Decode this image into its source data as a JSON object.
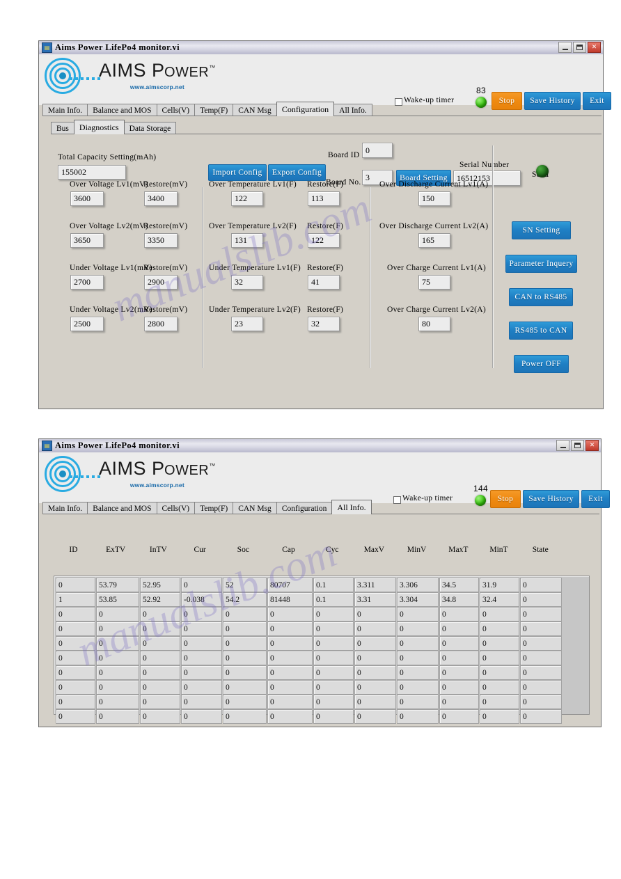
{
  "window1": {
    "title": "Aims Power LifePo4  monitor.vi",
    "titlebar_buttons": [
      "minimize",
      "maximize",
      "close"
    ],
    "logo": {
      "main": "AIMS POWER",
      "tm": "™",
      "url": "www.aimscorp.net"
    },
    "tabs": [
      {
        "label": "Main Info.",
        "active": false
      },
      {
        "label": "Balance and MOS",
        "active": false
      },
      {
        "label": "Cells(V)",
        "active": false
      },
      {
        "label": "Temp(F)",
        "active": false
      },
      {
        "label": "CAN Msg",
        "active": false
      },
      {
        "label": "Configuration",
        "active": true
      },
      {
        "label": "All Info.",
        "active": false
      }
    ],
    "subtabs": [
      {
        "label": "Bus",
        "active": false
      },
      {
        "label": "Diagnostics",
        "active": true
      },
      {
        "label": "Data Storage",
        "active": false
      }
    ],
    "toolbar": {
      "wakeup_label": "Wake-up timer",
      "wakeup_checked": false,
      "counter": "83",
      "stop_label": "Stop",
      "save_history_label": "Save History",
      "exit_label": "Exit"
    },
    "capacity": {
      "label": "Total Capacity Setting(mAh)",
      "value": "155002"
    },
    "import_label": "Import Config",
    "export_label": "Export Config",
    "board": {
      "id_label": "Board ID",
      "id_value": "0",
      "no_label": "Board No.",
      "no_value": "3",
      "setting_label": "Board Setting",
      "serial_label": "Serial Number",
      "serial_value": "16512153",
      "send_label": "Send"
    },
    "col1": [
      {
        "label": "Over Voltage Lv1(mV)",
        "value": "3600",
        "restore_label": "Restore(mV)",
        "restore_value": "3400"
      },
      {
        "label": "Over Voltage Lv2(mV)",
        "value": "3650",
        "restore_label": "Restore(mV)",
        "restore_value": "3350"
      },
      {
        "label": "Under Voltage Lv1(mV)",
        "value": "2700",
        "restore_label": "Restore(mV)",
        "restore_value": "2900"
      },
      {
        "label": "Under Voltage Lv2(mV)",
        "value": "2500",
        "restore_label": "Restore(mV)",
        "restore_value": "2800"
      }
    ],
    "col2": [
      {
        "label": "Over Temperature Lv1(F)",
        "value": "122",
        "restore_label": "Restore(F)",
        "restore_value": "113"
      },
      {
        "label": "Over Temperature Lv2(F)",
        "value": "131",
        "restore_label": "Restore(F)",
        "restore_value": "122"
      },
      {
        "label": "Under Temperature Lv1(F)",
        "value": "32",
        "restore_label": "Restore(F)",
        "restore_value": "41"
      },
      {
        "label": "Under Temperature Lv2(F)",
        "value": "23",
        "restore_label": "Restore(F)",
        "restore_value": "32"
      }
    ],
    "col3": [
      {
        "label": "Over Discharge Current Lv1(A)",
        "value": "150"
      },
      {
        "label": "Over Discharge Current Lv2(A)",
        "value": "165"
      },
      {
        "label": "Over Charge Current Lv1(A)",
        "value": "75"
      },
      {
        "label": "Over Charge Current Lv2(A)",
        "value": "80"
      }
    ],
    "side_buttons": [
      {
        "label": "SN Setting"
      },
      {
        "label": "Parameter Inquery"
      },
      {
        "label": "CAN to RS485"
      },
      {
        "label": "RS485 to CAN"
      },
      {
        "label": "Power OFF"
      }
    ]
  },
  "window2": {
    "title": "Aims Power LifePo4  monitor.vi",
    "logo": {
      "main": "AIMS POWER",
      "tm": "™",
      "url": "www.aimscorp.net"
    },
    "tabs": [
      {
        "label": "Main Info.",
        "active": false
      },
      {
        "label": "Balance and MOS",
        "active": false
      },
      {
        "label": "Cells(V)",
        "active": false
      },
      {
        "label": "Temp(F)",
        "active": false
      },
      {
        "label": "CAN Msg",
        "active": false
      },
      {
        "label": "Configuration",
        "active": false
      },
      {
        "label": "All Info.",
        "active": true
      }
    ],
    "toolbar": {
      "wakeup_label": "Wake-up timer",
      "wakeup_checked": false,
      "counter": "144",
      "stop_label": "Stop",
      "save_history_label": "Save History",
      "exit_label": "Exit"
    },
    "table": {
      "columns": [
        "ID",
        "ExTV",
        "InTV",
        "Cur",
        "Soc",
        "Cap",
        "Cyc",
        "MaxV",
        "MinV",
        "MaxT",
        "MinT",
        "State"
      ],
      "rows": [
        [
          "0",
          "53.79",
          "52.95",
          "0",
          "52",
          "80707",
          "0.1",
          "3.311",
          "3.306",
          "34.5",
          "31.9",
          "0"
        ],
        [
          "1",
          "53.85",
          "52.92",
          "-0.038",
          "54.2",
          "81448",
          "0.1",
          "3.31",
          "3.304",
          "34.8",
          "32.4",
          "0"
        ],
        [
          "0",
          "0",
          "0",
          "0",
          "0",
          "0",
          "0",
          "0",
          "0",
          "0",
          "0",
          "0"
        ],
        [
          "0",
          "0",
          "0",
          "0",
          "0",
          "0",
          "0",
          "0",
          "0",
          "0",
          "0",
          "0"
        ],
        [
          "0",
          "0",
          "0",
          "0",
          "0",
          "0",
          "0",
          "0",
          "0",
          "0",
          "0",
          "0"
        ],
        [
          "0",
          "0",
          "0",
          "0",
          "0",
          "0",
          "0",
          "0",
          "0",
          "0",
          "0",
          "0"
        ],
        [
          "0",
          "0",
          "0",
          "0",
          "0",
          "0",
          "0",
          "0",
          "0",
          "0",
          "0",
          "0"
        ],
        [
          "0",
          "0",
          "0",
          "0",
          "0",
          "0",
          "0",
          "0",
          "0",
          "0",
          "0",
          "0"
        ],
        [
          "0",
          "0",
          "0",
          "0",
          "0",
          "0",
          "0",
          "0",
          "0",
          "0",
          "0",
          "0"
        ],
        [
          "0",
          "0",
          "0",
          "0",
          "0",
          "0",
          "0",
          "0",
          "0",
          "0",
          "0",
          "0"
        ]
      ]
    }
  },
  "colors": {
    "accent_blue": "#1f7fc4",
    "accent_orange": "#ef8a11",
    "logo_cyan": "#29abe2",
    "led_green": "#39c90f",
    "window_face": "#d4d0c8"
  },
  "watermarks": [
    "manualslib.com"
  ]
}
